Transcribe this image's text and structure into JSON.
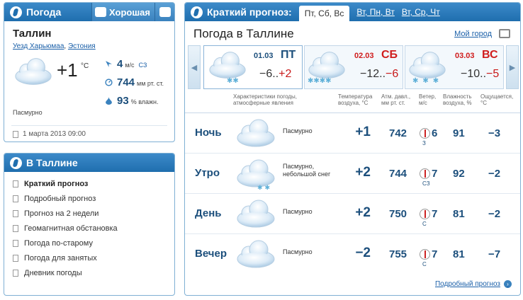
{
  "current": {
    "header": "Погода",
    "rating_good": "Хорошая",
    "city": "Таллин",
    "region_county": "Уезд Харьюмаа",
    "region_country": "Эстония",
    "temp": "+1",
    "temp_unit": "°C",
    "wind_speed": "4",
    "wind_unit": "м/с",
    "wind_dir": "СЗ",
    "pressure": "744",
    "pressure_unit": "мм рт. ст.",
    "humidity": "93",
    "humidity_unit": "% влажн.",
    "condition": "Пасмурно",
    "updated": "1 марта 2013 09:00"
  },
  "menu": {
    "header": "В Таллине",
    "items": [
      "Краткий прогноз",
      "Подробный прогноз",
      "Прогноз на 2 недели",
      "Геомагнитная обстановка",
      "Погода по-старому",
      "Погода для занятых",
      "Дневник погоды"
    ]
  },
  "forecast": {
    "tab_title": "Краткий прогноз:",
    "tabs": [
      "Пт, Сб, Вс",
      "Вт, Пн, Вт",
      "Вт, Ср, Чт"
    ],
    "title": "Погода в Таллине",
    "my_city": "Мой город",
    "days": [
      {
        "date": "01.03",
        "dow": "ПТ",
        "min": "−6..",
        "max": "+2"
      },
      {
        "date": "02.03",
        "dow": "СБ",
        "min": "−12..",
        "max": "−6"
      },
      {
        "date": "03.03",
        "dow": "ВС",
        "min": "−10..",
        "max": "−5"
      }
    ],
    "headers": {
      "chars": "Характеристики погоды, атмосферные явления",
      "temp": "Температура воздуха, °С",
      "press": "Атм. давл., мм рт. ст.",
      "wind": "Ветер, м/с",
      "hum": "Влажность воздуха, %",
      "feels": "Ощущается, °С"
    },
    "rows": [
      {
        "period": "Ночь",
        "cond": "Пасмурно",
        "temp": "+1",
        "press": "742",
        "wind": "6",
        "wdir": "З",
        "hum": "91",
        "feels": "−3"
      },
      {
        "period": "Утро",
        "cond": "Пасмурно, небольшой снег",
        "temp": "+2",
        "press": "744",
        "wind": "7",
        "wdir": "СЗ",
        "hum": "92",
        "feels": "−2"
      },
      {
        "period": "День",
        "cond": "Пасмурно",
        "temp": "+2",
        "press": "750",
        "wind": "7",
        "wdir": "С",
        "hum": "81",
        "feels": "−2"
      },
      {
        "period": "Вечер",
        "cond": "Пасмурно",
        "temp": "−2",
        "press": "755",
        "wind": "7",
        "wdir": "С",
        "hum": "81",
        "feels": "−7"
      }
    ],
    "more": "Подробный прогноз"
  }
}
